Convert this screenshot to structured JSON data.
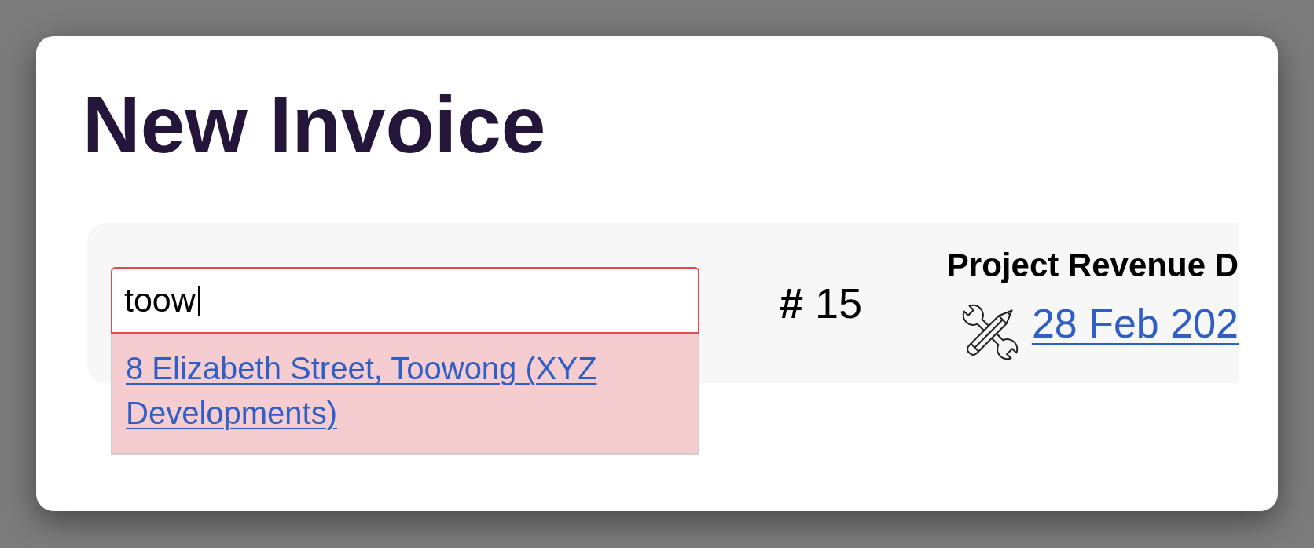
{
  "title": "New Invoice",
  "address_field": {
    "value": "toow",
    "focused": true,
    "suggestions": [
      {
        "label": "8 Elizabeth Street, Toowong (XYZ Developments)"
      }
    ]
  },
  "invoice_number": "**#** 15",
  "project_revenue_date": {
    "label": "Project Revenue D",
    "date": "28 Feb 202"
  }
}
